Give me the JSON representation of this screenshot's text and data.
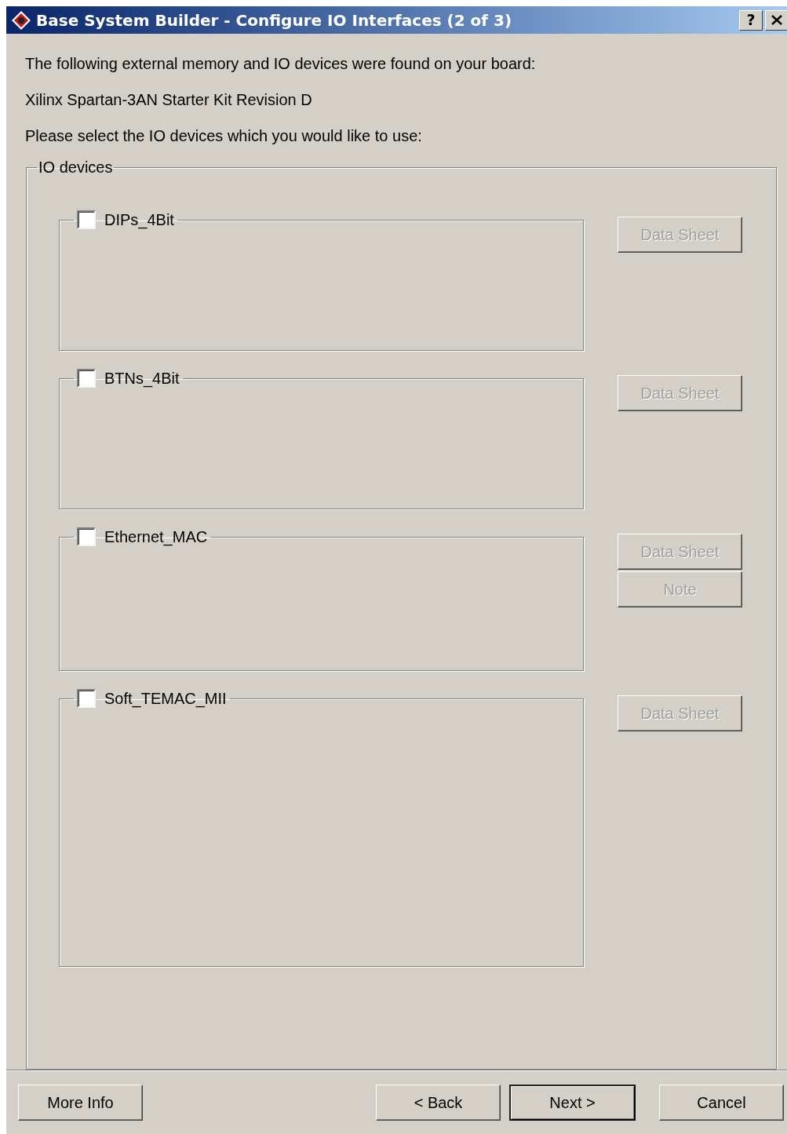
{
  "window": {
    "title": "Base System Builder - Configure IO Interfaces (2 of 3)",
    "help_button": "?"
  },
  "intro": [
    "The following external memory and IO devices were found on your board:",
    "Xilinx Spartan-3AN Starter Kit Revision D",
    "Please select the IO devices which you would like to use:"
  ],
  "io_devices": {
    "title": "IO devices",
    "devices": [
      {
        "name": "DIPs_4Bit",
        "checked": false,
        "buttons": [
          {
            "label": "Data Sheet",
            "disabled": true
          }
        ]
      },
      {
        "name": "BTNs_4Bit",
        "checked": false,
        "buttons": [
          {
            "label": "Data Sheet",
            "disabled": true
          }
        ]
      },
      {
        "name": "Ethernet_MAC",
        "checked": false,
        "buttons": [
          {
            "label": "Data Sheet",
            "disabled": true
          },
          {
            "label": "Note",
            "disabled": true
          }
        ]
      },
      {
        "name": "Soft_TEMAC_MII",
        "checked": false,
        "buttons": [
          {
            "label": "Data Sheet",
            "disabled": true
          }
        ]
      }
    ]
  },
  "footer_buttons": [
    {
      "label": "More Info",
      "default": false
    },
    {
      "label": "< Back",
      "default": false
    },
    {
      "label": "Next >",
      "default": true
    },
    {
      "label": "Cancel",
      "default": false
    }
  ]
}
